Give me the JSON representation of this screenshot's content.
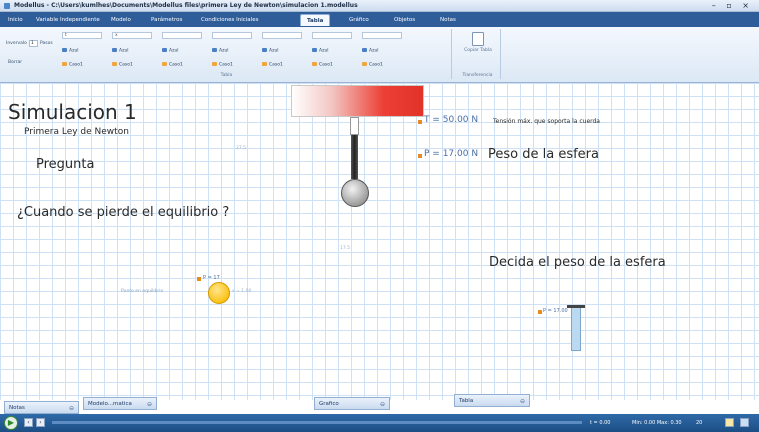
{
  "titlebar": {
    "text": "Modellus - C:\\Users\\kumlhes\\Documents\\Modellus files\\primera Ley de Newton\\simulacion 1.modellus",
    "controls": "– ▫ ×"
  },
  "tabs": [
    "Inicio",
    "Variable Independiente",
    "Modelo",
    "Parámetros",
    "Condiciones Iniciales",
    "Tabla",
    "Gráfico",
    "Objetos",
    "Notas"
  ],
  "active_tab": "Tabla",
  "ribbon": {
    "intervalo_label": "Invervalo",
    "intervalo_value": "1",
    "pasos_label": "Pasos",
    "borrar_label": "Borrar",
    "col_fields": [
      "t",
      "x",
      "",
      "",
      "",
      "",
      ""
    ],
    "azul_label": "Azul",
    "casos_label": "Caso1",
    "group_tabla": "Tabla",
    "copiar_label": "Copiar Tabla",
    "group_transfer": "Transferencia"
  },
  "canvas": {
    "title": "Simulacion 1",
    "subtitle": "Primera Ley de Newton",
    "pregunta": "Pregunta",
    "question": "¿Cuando se pierde el equilibrio ?",
    "tension_value": "T = 50.00 N",
    "tension_desc": "Tensión máx. que soporta la cuerda",
    "peso_value": "P = 17.00 N",
    "peso_desc": "Peso de la esfera",
    "decida": "Decida el peso de la esfera",
    "punto_label": "Punto en equilibrio",
    "ghost_1": "27.5",
    "ghost_2": "17.5",
    "small_val_1": "P = 17",
    "small_val_2": "x = 1.00",
    "small_val_3": "P = 17.00"
  },
  "panels": {
    "notas": "Notas",
    "modelo": "Modelo...matica",
    "grafico": "Grafico",
    "tabla": "Tabla",
    "pin": "⊖"
  },
  "status": {
    "time": "t = 0.00",
    "range": "Min: 0.00  Max: 0.30",
    "zoom": "20"
  },
  "colors": {
    "ribbon_tabs": "#2f5d9a",
    "block_red": "#e2322a",
    "marker_orange": "#e88b1e",
    "ball_yellow": "#fbc21a",
    "grid": "#cfe1f4"
  }
}
